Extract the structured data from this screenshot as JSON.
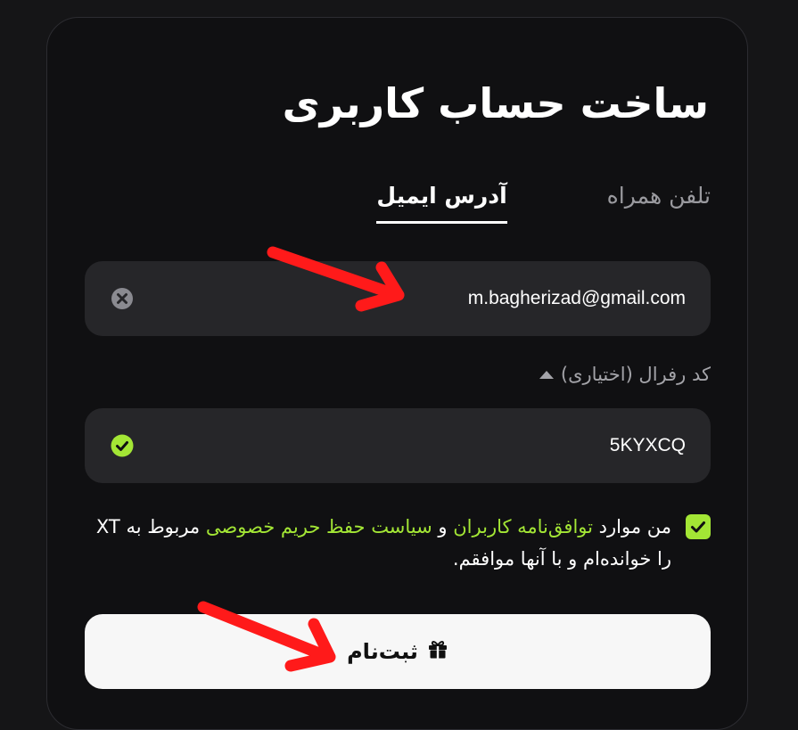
{
  "page": {
    "title": "ساخت حساب کاربری"
  },
  "tabs": [
    {
      "label": "آدرس ایمیل",
      "active": true
    },
    {
      "label": "تلفن همراه",
      "active": false
    }
  ],
  "email": {
    "value": "m.bagherizad@gmail.com",
    "clear_icon": "close-circle-icon"
  },
  "referral": {
    "label": "کد رفرال (اختیاری)",
    "toggle_icon": "triangle-up-icon",
    "value": "5KYXCQ",
    "valid_icon": "check-circle-icon"
  },
  "agreement": {
    "checked": true,
    "prefix": "من موارد ",
    "terms_link": "توافق‌نامه کاربران",
    "and": " و ",
    "privacy_link": "سیاست حفظ حریم خصوصی",
    "suffix": " مربوط به XT را خوانده‌ام و با آنها موافقم."
  },
  "submit": {
    "label": "ثبت‌نام",
    "icon": "gift-icon"
  },
  "colors": {
    "accent": "#a3e635",
    "annotation": "#ff1a1a",
    "card_bg": "#101012",
    "field_bg": "#262629"
  }
}
